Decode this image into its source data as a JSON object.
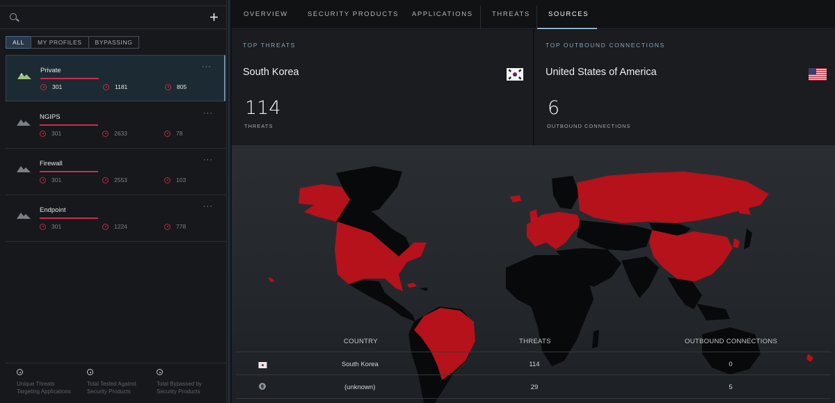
{
  "sidebar": {
    "filters": [
      {
        "label": "ALL",
        "active": true
      },
      {
        "label": "MY PROFILES",
        "active": false
      },
      {
        "label": "BYPASSING",
        "active": false
      }
    ],
    "profiles": [
      {
        "name": "Private",
        "stats": [
          "301",
          "1181",
          "805"
        ],
        "active": true
      },
      {
        "name": "NGIPS",
        "stats": [
          "301",
          "2633",
          "78"
        ],
        "active": false
      },
      {
        "name": "Firewall",
        "stats": [
          "301",
          "2553",
          "103"
        ],
        "active": false
      },
      {
        "name": "Endpoint",
        "stats": [
          "301",
          "1224",
          "778"
        ],
        "active": false
      }
    ],
    "more_label": "···",
    "footer": [
      {
        "line1": "Unique Threats",
        "line2": "Targeting Applications"
      },
      {
        "line1": "Total Tested Against",
        "line2": "Security Products"
      },
      {
        "line1": "Total Bypassed by",
        "line2": "Security Products"
      }
    ]
  },
  "tabs": [
    {
      "label": "OVERVIEW",
      "active": false
    },
    {
      "label": "SECURITY PRODUCTS",
      "active": false
    },
    {
      "label": "APPLICATIONS",
      "active": false
    },
    {
      "label": "THREATS",
      "active": false
    },
    {
      "label": "SOURCES",
      "active": true
    }
  ],
  "cards": {
    "top_threats": {
      "title": "TOP THREATS",
      "country": "South Korea",
      "value": "114",
      "caption": "THREATS",
      "flag": "south-korea-flag"
    },
    "top_outbound": {
      "title": "TOP OUTBOUND CONNECTIONS",
      "country": "United States of America",
      "value": "6",
      "caption": "OUTBOUND CONNECTIONS",
      "flag": "usa-flag"
    }
  },
  "table": {
    "headers": {
      "country": "COUNTRY",
      "threats": "THREATS",
      "outbound": "OUTBOUND CONNECTIONS"
    },
    "rows": [
      {
        "icon": "south-korea-flag-icon",
        "country": "South Korea",
        "threats": "114",
        "outbound": "0"
      },
      {
        "icon": "globe-icon",
        "country": "(unknown)",
        "threats": "29",
        "outbound": "5"
      }
    ]
  },
  "colors": {
    "accent": "#8cb4cc",
    "threat_red": "#b5121b",
    "land_dark": "#08090a",
    "profile_line": "#d02a4f"
  }
}
